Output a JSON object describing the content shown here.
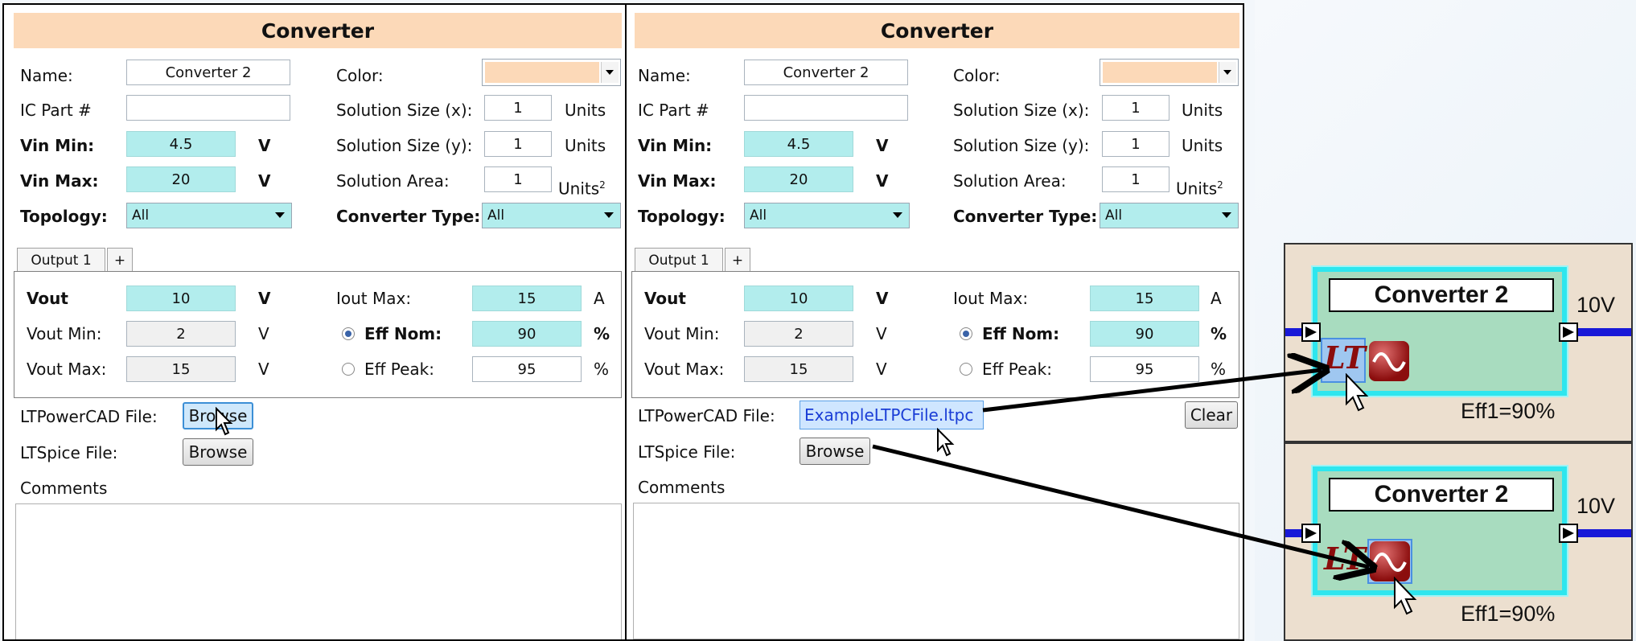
{
  "colors": {
    "title_bg": "#fcd9b8",
    "cyan_field": "#b2eded",
    "block_fill": "#a8dcbf",
    "block_border": "#2ee6ee",
    "bus": "#1818d8"
  },
  "panels": [
    {
      "title": "Converter",
      "name_label": "Name:",
      "name_value": "Converter 2",
      "color_label": "Color:",
      "ic_label": "IC Part #",
      "ic_value": "",
      "sx_label": "Solution Size (x):",
      "sx_value": "1",
      "sx_unit": "Units",
      "sy_label": "Solution Size (y):",
      "sy_value": "1",
      "sy_unit": "Units",
      "area_label": "Solution Area:",
      "area_value": "1",
      "area_unit": "Units",
      "area_sup": "2",
      "vinmin_label": "Vin Min:",
      "vinmin_value": "4.5",
      "vinmin_unit": "V",
      "vinmax_label": "Vin Max:",
      "vinmax_value": "20",
      "vinmax_unit": "V",
      "topology_label": "Topology:",
      "topology_value": "All",
      "convtype_label": "Converter Type:",
      "convtype_value": "All",
      "tab_label": "Output 1",
      "tab_add": "+",
      "vout_label": "Vout",
      "vout_value": "10",
      "vout_unit": "V",
      "voutmin_label": "Vout Min:",
      "voutmin_value": "2",
      "voutmin_unit": "V",
      "voutmax_label": "Vout Max:",
      "voutmax_value": "15",
      "voutmax_unit": "V",
      "ioutmax_label": "Iout Max:",
      "ioutmax_value": "15",
      "ioutmax_unit": "A",
      "effnom_label": "Eff Nom:",
      "effnom_value": "90",
      "effnom_unit": "%",
      "effpeak_label": "Eff Peak:",
      "effpeak_value": "95",
      "effpeak_unit": "%",
      "ltpc_label": "LTPowerCAD File:",
      "ltpc_button": "Browse",
      "lts_label": "LTSpice File:",
      "lts_button": "Browse",
      "comments_label": "Comments"
    },
    {
      "title": "Converter",
      "name_label": "Name:",
      "name_value": "Converter 2",
      "color_label": "Color:",
      "ic_label": "IC Part #",
      "ic_value": "",
      "sx_label": "Solution Size (x):",
      "sx_value": "1",
      "sx_unit": "Units",
      "sy_label": "Solution Size (y):",
      "sy_value": "1",
      "sy_unit": "Units",
      "area_label": "Solution Area:",
      "area_value": "1",
      "area_unit": "Units",
      "area_sup": "2",
      "vinmin_label": "Vin Min:",
      "vinmin_value": "4.5",
      "vinmin_unit": "V",
      "vinmax_label": "Vin Max:",
      "vinmax_value": "20",
      "vinmax_unit": "V",
      "topology_label": "Topology:",
      "topology_value": "All",
      "convtype_label": "Converter Type:",
      "convtype_value": "All",
      "tab_label": "Output 1",
      "tab_add": "+",
      "vout_label": "Vout",
      "vout_value": "10",
      "vout_unit": "V",
      "voutmin_label": "Vout Min:",
      "voutmin_value": "2",
      "voutmin_unit": "V",
      "voutmax_label": "Vout Max:",
      "voutmax_value": "15",
      "voutmax_unit": "V",
      "ioutmax_label": "Iout Max:",
      "ioutmax_value": "15",
      "ioutmax_unit": "A",
      "effnom_label": "Eff Nom:",
      "effnom_value": "90",
      "effnom_unit": "%",
      "effpeak_label": "Eff Peak:",
      "effpeak_value": "95",
      "effpeak_unit": "%",
      "ltpc_label": "LTPowerCAD File:",
      "ltpc_file": "ExampleLTPCFile.ltpc",
      "clear_button": "Clear",
      "lts_label": "LTSpice File:",
      "lts_button": "Browse",
      "comments_label": "Comments"
    }
  ],
  "previews": [
    {
      "title": "Converter 2",
      "voltage": "10V",
      "efficiency": "Eff1=90%",
      "lt_logo": "LT",
      "highlighted_icon": "ltpowercad-icon"
    },
    {
      "title": "Converter 2",
      "voltage": "10V",
      "efficiency": "Eff1=90%",
      "lt_logo": "LT",
      "highlighted_icon": "ltspice-icon"
    }
  ]
}
